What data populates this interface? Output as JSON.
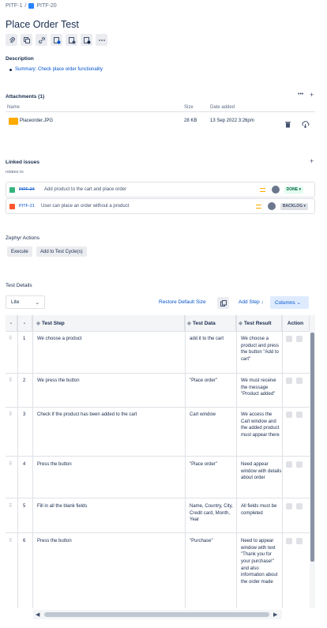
{
  "breadcrumb": {
    "project": "PITF-1",
    "separator": "/",
    "issue": "PITF-20"
  },
  "issue": {
    "title": "Place Order Test"
  },
  "description": {
    "label": "Description",
    "summary": "Summary: Check place order functionality"
  },
  "attachments": {
    "label": "Attachments (1)",
    "col_name": "Name",
    "col_size": "Size",
    "col_date": "Date added",
    "file": {
      "name": "Placeorder.JPG",
      "size": "28 KB",
      "date": "13 Sep 2022 3:26pm"
    },
    "more": "•••",
    "add": "+"
  },
  "linked_issues": {
    "label": "Linked issues",
    "relation": "relates to",
    "add": "+",
    "items": [
      {
        "key": "PITF-24",
        "summary": "Add product to the cart and place order",
        "status": "DONE",
        "type_color": "#36b37e",
        "status_color": "#e3fcef",
        "status_text_color": "#006644"
      },
      {
        "key": "PITF-21",
        "summary": "User can place an order without a product",
        "status": "BACKLOG",
        "type_color": "#ff5630",
        "status_color": "#dfe1e6",
        "status_text_color": "#42526e"
      }
    ]
  },
  "zephyr": {
    "label": "Zephyr Actions",
    "execute": "Execute",
    "add_to_cycle": "Add to Test Cycle(s)"
  },
  "test_details": {
    "label": "Test Details",
    "view": "Lite",
    "restore": "Restore Default Size",
    "add_step": "Add Step",
    "columns": "Columns",
    "headers": {
      "drag": "-",
      "num": "-",
      "step": "Test Step",
      "data": "Test Data",
      "result": "Test Result",
      "action": "Action"
    },
    "rows": [
      {
        "n": "1",
        "step": "We choose a product",
        "data": "add it to the cart",
        "result": "We choose a product and press the button \"Add to cart\""
      },
      {
        "n": "2",
        "step": "We press the button",
        "data": "\"Place order\"",
        "result": "We must receive the message \"Product added\""
      },
      {
        "n": "3",
        "step": "Check if the product has been added to the cart",
        "data": "Cart window",
        "result": "We access the Cart window and the added product must appear there"
      },
      {
        "n": "4",
        "step": "Press the button",
        "data": "\"Place order\"",
        "result": "Need appear window with details about order"
      },
      {
        "n": "5",
        "step": "Fill in all the blank fields",
        "data": "Name, Country, City, Credit card, Month, Year",
        "result": "All fields must be completed"
      },
      {
        "n": "6",
        "step": "Press the button",
        "data": "\"Purchase\"",
        "result": "Need to appear window with text \"Thank you for your purchase!\" and also information about the order made"
      }
    ]
  },
  "colors": {
    "link": "#0052cc",
    "accent": "#0052cc",
    "columns_bg": "#deebff"
  }
}
